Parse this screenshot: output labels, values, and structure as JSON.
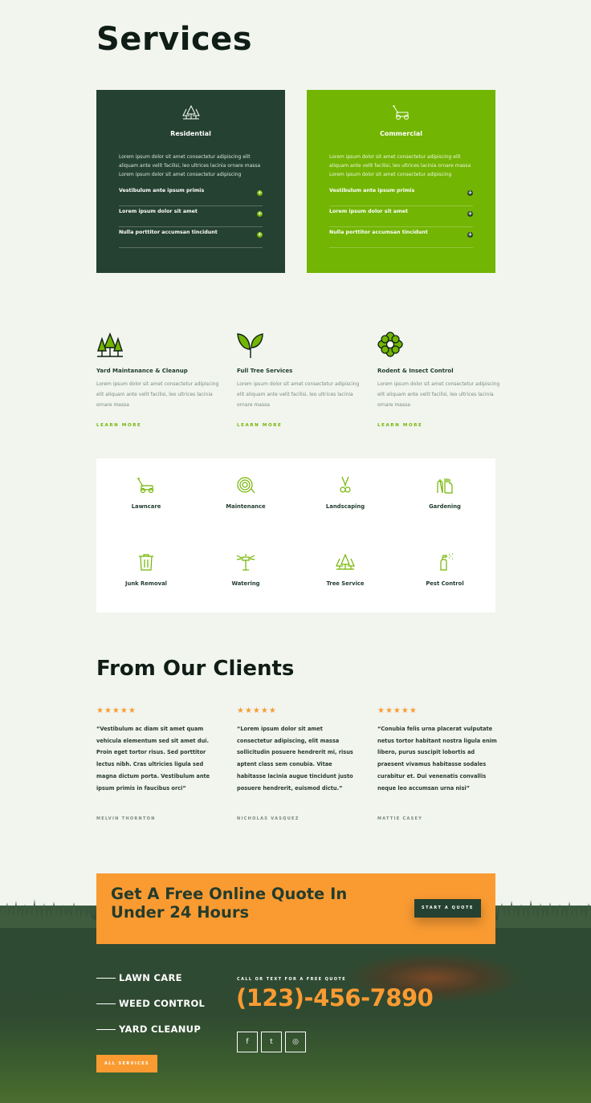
{
  "services": {
    "heading": "Services",
    "cards": [
      {
        "title": "Residential",
        "icon": "trees-icon",
        "desc": "Lorem ipsum dolor sit amet consectetur adipiscing elit aliquam ante velit facilisi, leo ultrices lacinia ornare massa Lorem ipsum dolor sit amet consectetur adipiscing",
        "items": [
          "Vestibulum ante ipsum primis",
          "Lorem ipsum dolor sit amet",
          "Nulla porttitor accumsan tincidunt"
        ]
      },
      {
        "title": "Commercial",
        "icon": "lawnmower-icon",
        "desc": "Lorem ipsum dolor sit amet consectetur adipiscing elit aliquam ante velit facilisi, leo ultrices lacinia ornare massa Lorem ipsum dolor sit amet consectetur adipiscing",
        "items": [
          "Vestibulum ante ipsum primis",
          "Lorem ipsum dolor sit amet",
          "Nulla porttitor accumsan tincidunt"
        ]
      }
    ]
  },
  "features": [
    {
      "title": "Yard Maintanance & Cleanup",
      "desc": "Lorem ipsum dolor sit amet consectetur adipiscing elit aliquam ante velit facilisi, leo ultrices lacinia ornare massa",
      "link": "LEARN MORE",
      "icon": "trees-icon"
    },
    {
      "title": "Full Tree Services",
      "desc": "Lorem ipsum dolor sit amet consectetur adipiscing elit aliquam ante velit facilisi, leo ultrices lacinia ornare massa",
      "link": "LEARN MORE",
      "icon": "leaf-sprout-icon"
    },
    {
      "title": "Rodent & Insect Control",
      "desc": "Lorem ipsum dolor sit amet consectetur adipiscing elit aliquam ante velit facilisi, leo ultrices lacinia ornare massa",
      "link": "LEARN MORE",
      "icon": "flower-icon"
    }
  ],
  "service_grid": [
    {
      "label": "Lawncare",
      "icon": "lawnmower-icon"
    },
    {
      "label": "Maintenance",
      "icon": "hose-icon"
    },
    {
      "label": "Landscaping",
      "icon": "shears-icon"
    },
    {
      "label": "Gardening",
      "icon": "gloves-icon"
    },
    {
      "label": "Junk Removal",
      "icon": "trash-can-icon"
    },
    {
      "label": "Watering",
      "icon": "sprinkler-icon"
    },
    {
      "label": "Tree Service",
      "icon": "trees-icon"
    },
    {
      "label": "Pest Control",
      "icon": "spray-bottle-icon"
    }
  ],
  "clients": {
    "heading": "From Our Clients",
    "stars": "★★★★★",
    "testimonials": [
      {
        "quote": "“Vestibulum ac diam sit amet quam vehicula elementum sed sit amet dui. Proin eget tortor risus. Sed porttitor lectus nibh. Cras ultricies ligula sed magna dictum porta. Vestibulum ante ipsum primis in faucibus orci”",
        "author": "MELVIN THORNTON"
      },
      {
        "quote": "“Lorem ipsum dolor sit amet consectetur adipiscing, elit massa sollicitudin posuere hendrerit mi, risus aptent class sem conubia. Vitae habitasse lacinia augue tincidunt justo posuere hendrerit, euismod dictu.”",
        "author": "NICHOLAS VASQUEZ"
      },
      {
        "quote": "“Conubia felis urna placerat vulputate netus tortor habitant nostra ligula enim libero, purus suscipit lobortis ad praesent vivamus habitasse sodales curabitur et. Dui venenatis convallis neque leo accumsan urna nisi”",
        "author": "MATTIE CASEY"
      }
    ]
  },
  "banner": {
    "title": "Get A Free Online Quote In Under 24 Hours",
    "button": "START A QUOTE"
  },
  "footer": {
    "links": [
      "LAWN CARE",
      "WEED CONTROL",
      "YARD CLEANUP"
    ],
    "all_button": "ALL SERVICES",
    "call_label": "CALL OR TEXT FOR A FREE QUOTE",
    "phone": "(123)-456-7890",
    "social": [
      {
        "icon": "facebook-icon",
        "glyph": "f"
      },
      {
        "icon": "twitter-icon",
        "glyph": "t"
      },
      {
        "icon": "instagram-icon",
        "glyph": "◎"
      }
    ]
  },
  "colors": {
    "dark_green": "#254131",
    "lime": "#72b502",
    "orange": "#fa9b32",
    "background": "#f1f5ee"
  }
}
